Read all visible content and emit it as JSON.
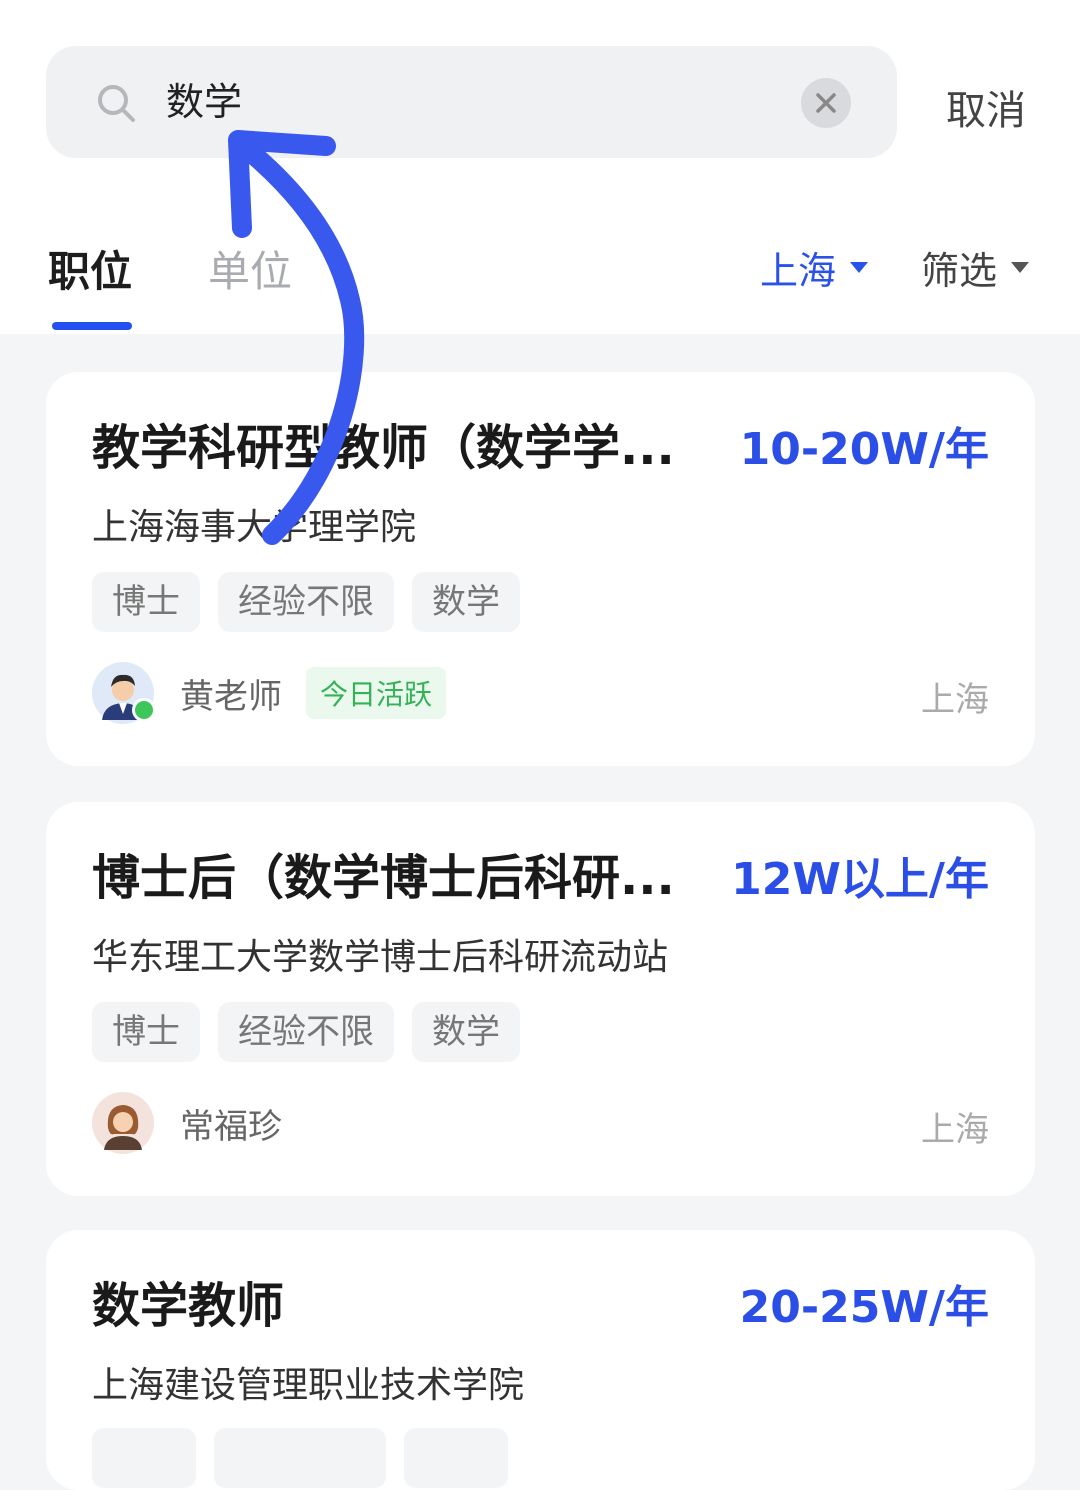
{
  "search": {
    "query": "数学",
    "cancel_label": "取消"
  },
  "tabs": [
    {
      "label": "职位"
    },
    {
      "label": "单位"
    }
  ],
  "filters": {
    "city": "上海",
    "filter_label": "筛选"
  },
  "colors": {
    "accent": "#2a52e8",
    "salary": "#2a4ee6",
    "active_green": "#34b256"
  },
  "jobs": [
    {
      "title": "教学科研型教师（数学学...",
      "salary": "10-20W/年",
      "company": "上海海事大学理学院",
      "tags": [
        "博士",
        "经验不限",
        "数学"
      ],
      "poster": "黄老师",
      "active_badge": "今日活跃",
      "city": "上海"
    },
    {
      "title": "博士后（数学博士后科研...",
      "salary": "12W以上/年",
      "company": "华东理工大学数学博士后科研流动站",
      "tags": [
        "博士",
        "经验不限",
        "数学"
      ],
      "poster": "常福珍",
      "city": "上海"
    },
    {
      "title": "数学教师",
      "salary": "20-25W/年",
      "company": "上海建设管理职业技术学院"
    }
  ]
}
